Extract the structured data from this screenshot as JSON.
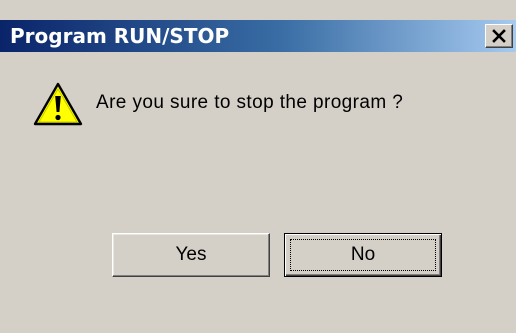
{
  "window": {
    "title": "Program RUN/STOP",
    "close_icon": "close-icon"
  },
  "message": {
    "icon": "warning-icon",
    "text": "Are you sure to stop the program ?"
  },
  "buttons": {
    "yes_label": "Yes",
    "no_label": "No"
  },
  "colors": {
    "dialog_face": "#d4d0c8",
    "title_start": "#0a246a",
    "title_end": "#a6caf0",
    "warning_yellow": "#ffff00"
  }
}
